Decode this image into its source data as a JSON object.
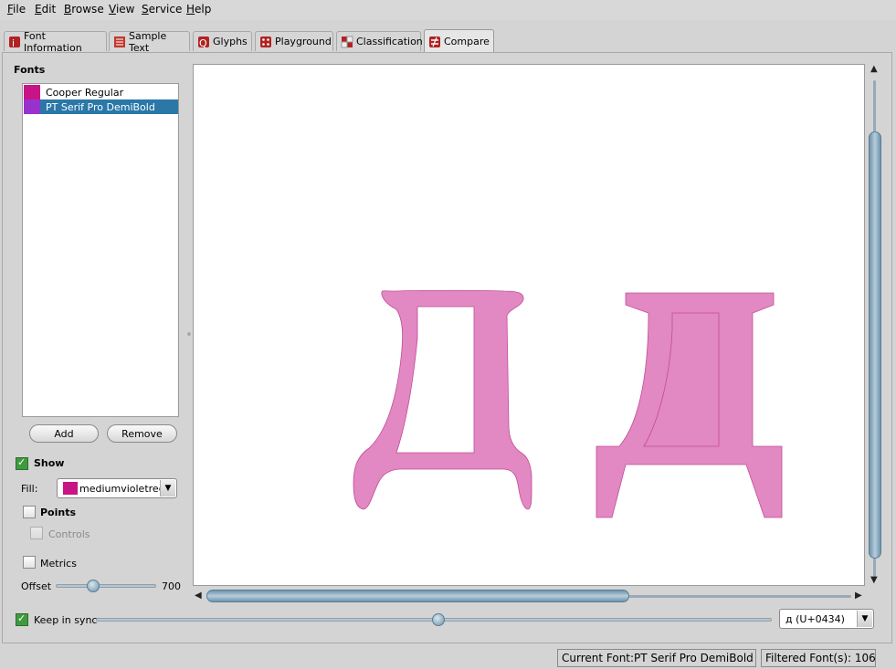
{
  "menu": [
    {
      "pre": "",
      "u": "F",
      "rest": "ile"
    },
    {
      "pre": "",
      "u": "E",
      "rest": "dit"
    },
    {
      "pre": "",
      "u": "B",
      "rest": "rowse"
    },
    {
      "pre": "",
      "u": "V",
      "rest": "iew"
    },
    {
      "pre": "",
      "u": "S",
      "rest": "ervice"
    },
    {
      "pre": "",
      "u": "H",
      "rest": "elp"
    }
  ],
  "tabs": [
    "Font Information",
    "Sample Text",
    "Glyphs",
    "Playground",
    "Classification",
    "Compare"
  ],
  "active_tab": "Compare",
  "left_panel": {
    "fonts_title": "Fonts",
    "fonts": [
      {
        "name": "Cooper Regular",
        "color": "#c71585"
      },
      {
        "name": "PT Serif Pro DemiBold",
        "color": "#9932cc"
      }
    ],
    "add_label": "Add",
    "remove_label": "Remove",
    "show_label": "Show",
    "fill_label": "Fill:",
    "fill_value": "mediumvioletred",
    "fill_color": "#c71585",
    "points_label": "Points",
    "controls_label": "Controls",
    "metrics_label": "Metrics",
    "offset_label": "Offset",
    "offset_value": "700"
  },
  "bottom": {
    "sync_label": "Keep in sync",
    "glyph_value": "д  (U+0434)"
  },
  "status": {
    "current_font": "Current Font:PT Serif Pro DemiBold",
    "filtered": "Filtered Font(s): 106"
  },
  "glyph_color": "#e288c2"
}
